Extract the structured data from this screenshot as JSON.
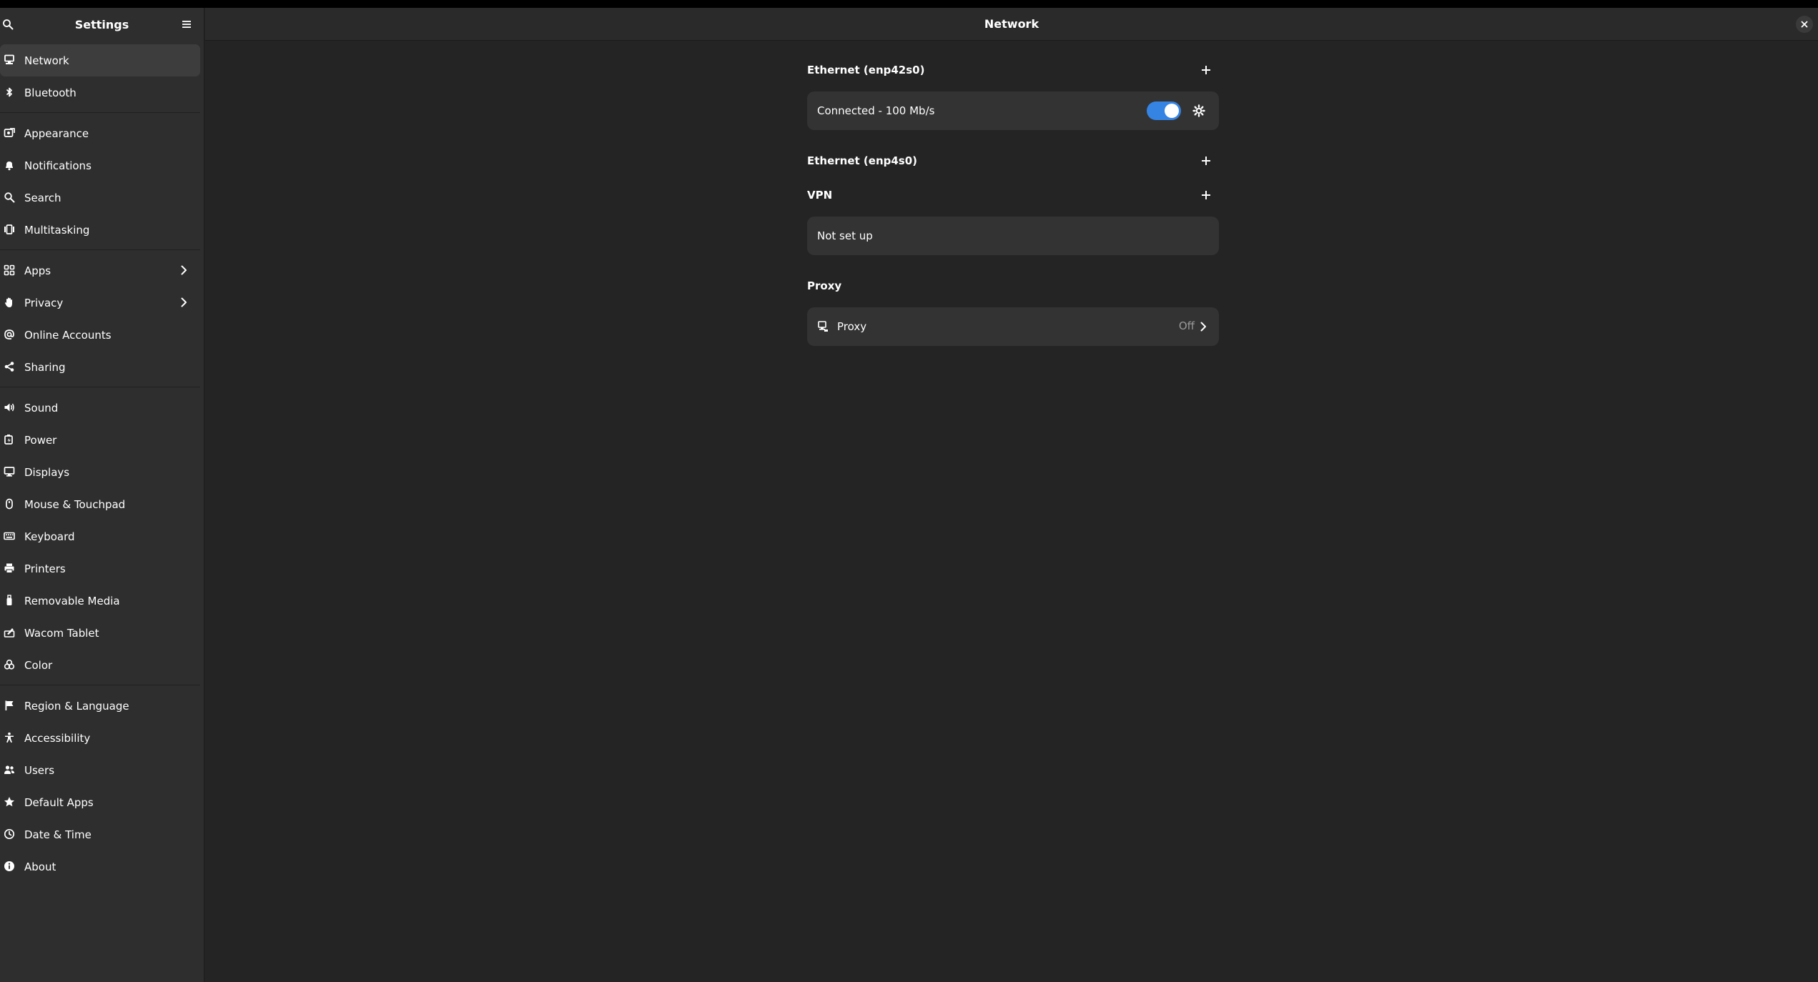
{
  "colors": {
    "window_bg": "#242424",
    "sidebar_bg": "#2e2e2e",
    "card_bg": "#333333",
    "accent": "#3584e4",
    "dim_text": "#9a9a9a"
  },
  "sidebar": {
    "title": "Settings",
    "search_icon": "search-icon",
    "menu_icon": "hamburger-menu-icon",
    "groups": [
      [
        {
          "label": "Network",
          "icon": "network-icon",
          "selected": true
        },
        {
          "label": "Bluetooth",
          "icon": "bluetooth-icon"
        }
      ],
      [
        {
          "label": "Appearance",
          "icon": "appearance-icon"
        },
        {
          "label": "Notifications",
          "icon": "bell-icon"
        },
        {
          "label": "Search",
          "icon": "search-icon"
        },
        {
          "label": "Multitasking",
          "icon": "multitasking-icon"
        }
      ],
      [
        {
          "label": "Apps",
          "icon": "apps-grid-icon",
          "chevron": true
        },
        {
          "label": "Privacy",
          "icon": "hand-icon",
          "chevron": true
        },
        {
          "label": "Online Accounts",
          "icon": "at-sign-icon"
        },
        {
          "label": "Sharing",
          "icon": "share-icon"
        }
      ],
      [
        {
          "label": "Sound",
          "icon": "speaker-icon"
        },
        {
          "label": "Power",
          "icon": "battery-icon"
        },
        {
          "label": "Displays",
          "icon": "monitor-icon"
        },
        {
          "label": "Mouse & Touchpad",
          "icon": "mouse-icon"
        },
        {
          "label": "Keyboard",
          "icon": "keyboard-icon"
        },
        {
          "label": "Printers",
          "icon": "printer-icon"
        },
        {
          "label": "Removable Media",
          "icon": "usb-drive-icon"
        },
        {
          "label": "Wacom Tablet",
          "icon": "tablet-icon"
        },
        {
          "label": "Color",
          "icon": "color-icon"
        }
      ],
      [
        {
          "label": "Region & Language",
          "icon": "flag-icon"
        },
        {
          "label": "Accessibility",
          "icon": "accessibility-icon"
        },
        {
          "label": "Users",
          "icon": "users-icon"
        },
        {
          "label": "Default Apps",
          "icon": "star-icon"
        },
        {
          "label": "Date & Time",
          "icon": "clock-icon"
        },
        {
          "label": "About",
          "icon": "info-icon"
        }
      ]
    ]
  },
  "main": {
    "title": "Network",
    "close_icon": "close-icon",
    "sections": {
      "ethernet1": {
        "title": "Ethernet (enp42s0)",
        "status": "Connected - 100 Mb/s",
        "toggle_on": true
      },
      "ethernet2": {
        "title": "Ethernet (enp4s0)"
      },
      "vpn": {
        "title": "VPN",
        "status": "Not set up"
      },
      "proxy": {
        "title": "Proxy",
        "row_label": "Proxy",
        "state": "Off"
      }
    }
  }
}
